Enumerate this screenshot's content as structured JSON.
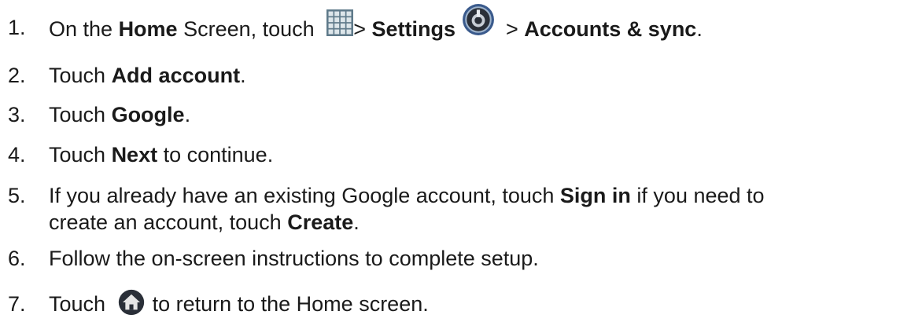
{
  "steps": [
    {
      "num": "1.",
      "parts": [
        {
          "t": "On the "
        },
        {
          "b": "Home"
        },
        {
          "t": " Screen, touch "
        },
        {
          "icon": "apps-grid-icon"
        },
        {
          "t": "> "
        },
        {
          "b": "Settings"
        },
        {
          "icon": "settings-icon"
        },
        {
          "t": "> "
        },
        {
          "b": "Accounts & sync"
        },
        {
          "t": "."
        }
      ]
    },
    {
      "num": "2.",
      "parts": [
        {
          "t": "Touch "
        },
        {
          "b": "Add account"
        },
        {
          "t": "."
        }
      ]
    },
    {
      "num": "3.",
      "parts": [
        {
          "t": "Touch "
        },
        {
          "b": "Google"
        },
        {
          "t": "."
        }
      ]
    },
    {
      "num": "4.",
      "parts": [
        {
          "t": "Touch "
        },
        {
          "b": "Next"
        },
        {
          "t": " to continue."
        }
      ]
    },
    {
      "num": "5.",
      "parts": [
        {
          "t": "If you already have an existing Google account, touch "
        },
        {
          "b": "Sign in"
        },
        {
          "t": " if you need to"
        }
      ],
      "cont": [
        {
          "t": "create an account, touch "
        },
        {
          "b": "Create"
        },
        {
          "t": "."
        }
      ]
    },
    {
      "num": "6.",
      "parts": [
        {
          "t": "Follow the on-screen instructions to complete setup."
        }
      ]
    },
    {
      "num": "7.",
      "parts": [
        {
          "t": "Touch "
        },
        {
          "icon": "home-icon"
        },
        {
          "t": "to return to the Home screen."
        }
      ]
    }
  ],
  "colors": {
    "text": "#1a1a1a",
    "icon_blue": "#3a5a8c",
    "icon_dark": "#2a2f38"
  }
}
